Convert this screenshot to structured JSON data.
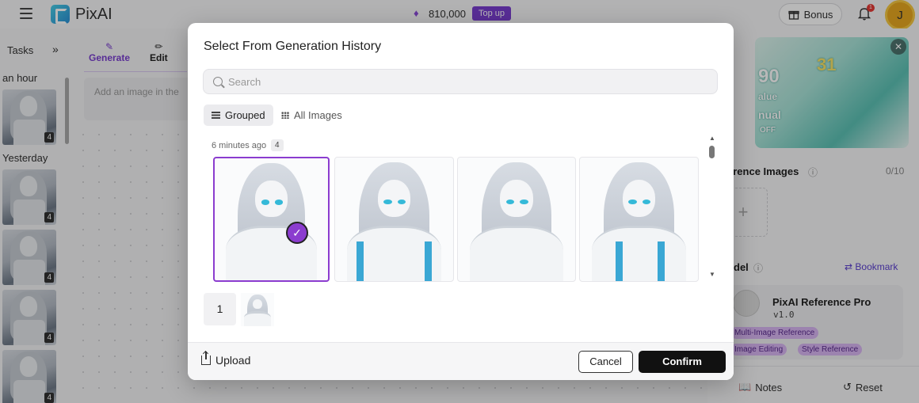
{
  "app": {
    "logo_text": "PixAI"
  },
  "header": {
    "credits": "810,000",
    "topup_label": "Top up",
    "bonus_label": "Bonus",
    "notification_count": "1",
    "avatar_initial": "J"
  },
  "tasks": {
    "title": "Tasks",
    "expand_glyph": "»",
    "groups": [
      {
        "label": "an hour"
      },
      {
        "label": "Yesterday"
      }
    ],
    "thumb_count": "4"
  },
  "generate": {
    "tabs": [
      {
        "label": "Generate",
        "active": true
      },
      {
        "label": "Edit",
        "active": false
      }
    ],
    "prompt_placeholder": "Add an image in the"
  },
  "right_panel": {
    "reference_label": "erence Images",
    "reference_count": "0/10",
    "add_glyph": "+",
    "model_label": "del",
    "bookmark_label": "Bookmark",
    "model": {
      "name": "PixAI Reference Pro",
      "version": "v1.0"
    },
    "tags": [
      "Multi-Image Reference",
      "Image Editing",
      "Style Reference"
    ],
    "notes_label": "Notes",
    "reset_label": "Reset",
    "banner": {
      "big_text": "90",
      "sub_text": "alue",
      "mid_text": "nual",
      "bottom_text": "OFF",
      "day_text": "31"
    }
  },
  "modal": {
    "title": "Select From Generation History",
    "search_placeholder": "Search",
    "view_options": [
      {
        "label": "Grouped",
        "active": true
      },
      {
        "label": "All Images",
        "active": false
      }
    ],
    "group": {
      "time_label": "6 minutes ago",
      "count": "4"
    },
    "selected_count": "1",
    "upload_label": "Upload",
    "cancel_label": "Cancel",
    "confirm_label": "Confirm"
  },
  "colors": {
    "accent": "#8b3ccf",
    "topup": "#7a3fd0",
    "tag_bg": "#d9b6f3",
    "confirm_bg": "#111111"
  }
}
